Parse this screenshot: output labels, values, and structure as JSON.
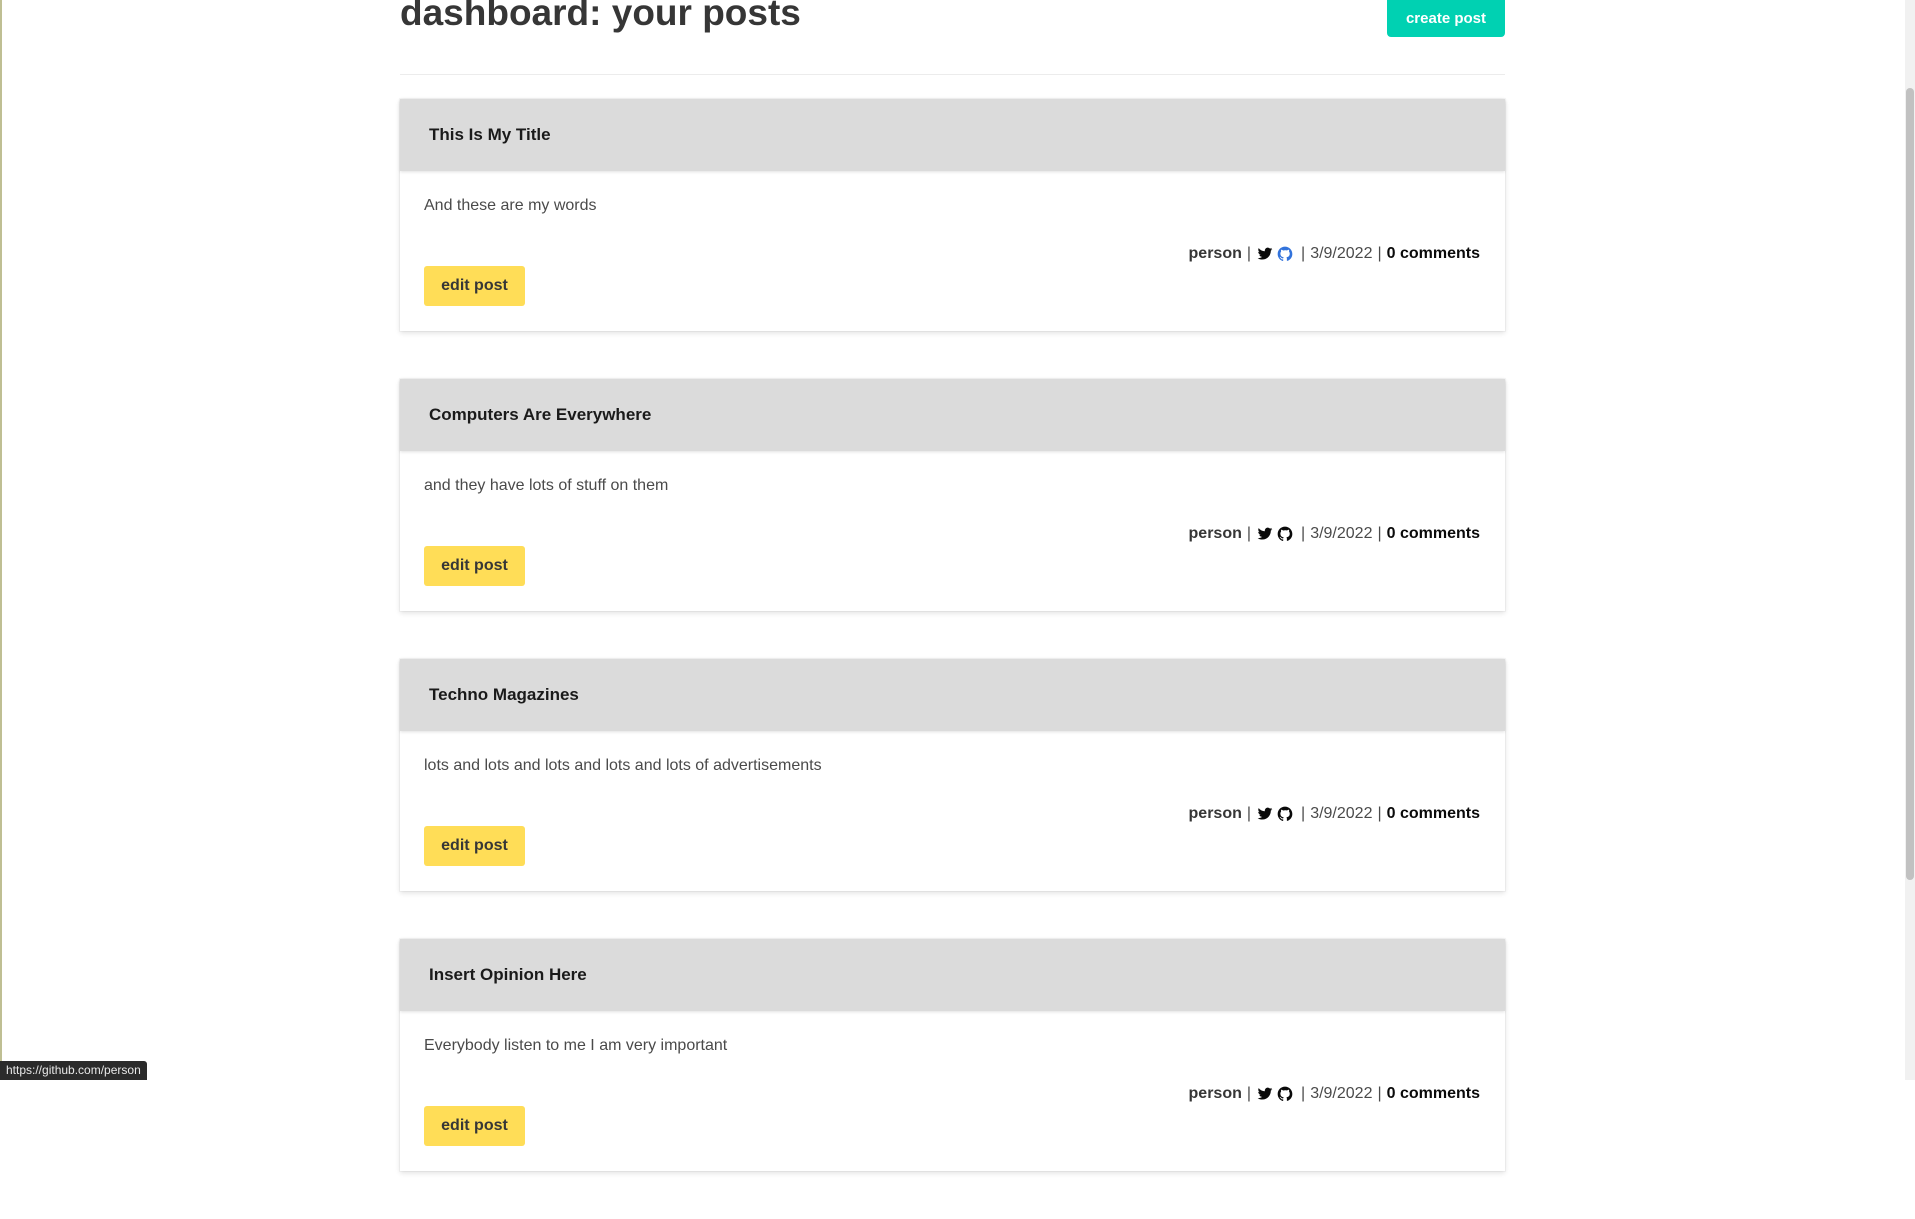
{
  "page": {
    "title": "dashboard: your posts",
    "create_label": "create post"
  },
  "colors": {
    "accent": "#00d1b2",
    "edit_button": "#ffdd57",
    "card_header": "#dbdbdb",
    "github_highlight": "#3273dc"
  },
  "posts": [
    {
      "title": "This Is My Title",
      "body": "And these are my words",
      "author": "person",
      "separator": "|",
      "date": "3/9/2022",
      "comments": "0 comments",
      "edit_label": "edit post",
      "icons": [
        "twitter-icon",
        "github-icon"
      ]
    },
    {
      "title": "Computers Are Everywhere",
      "body": "and they have lots of stuff on them",
      "author": "person",
      "separator": "|",
      "date": "3/9/2022",
      "comments": "0 comments",
      "edit_label": "edit post",
      "icons": [
        "twitter-icon",
        "github-icon"
      ]
    },
    {
      "title": "Techno Magazines",
      "body": "lots and lots and lots and lots and lots of advertisements",
      "author": "person",
      "separator": "|",
      "date": "3/9/2022",
      "comments": "0 comments",
      "edit_label": "edit post",
      "icons": [
        "twitter-icon",
        "github-icon"
      ]
    },
    {
      "title": "Insert Opinion Here",
      "body": "Everybody listen to me I am very important",
      "author": "person",
      "separator": "|",
      "date": "3/9/2022",
      "comments": "0 comments",
      "edit_label": "edit post",
      "icons": [
        "twitter-icon",
        "github-icon"
      ]
    }
  ],
  "status_bar": {
    "url": "https://github.com/person"
  }
}
